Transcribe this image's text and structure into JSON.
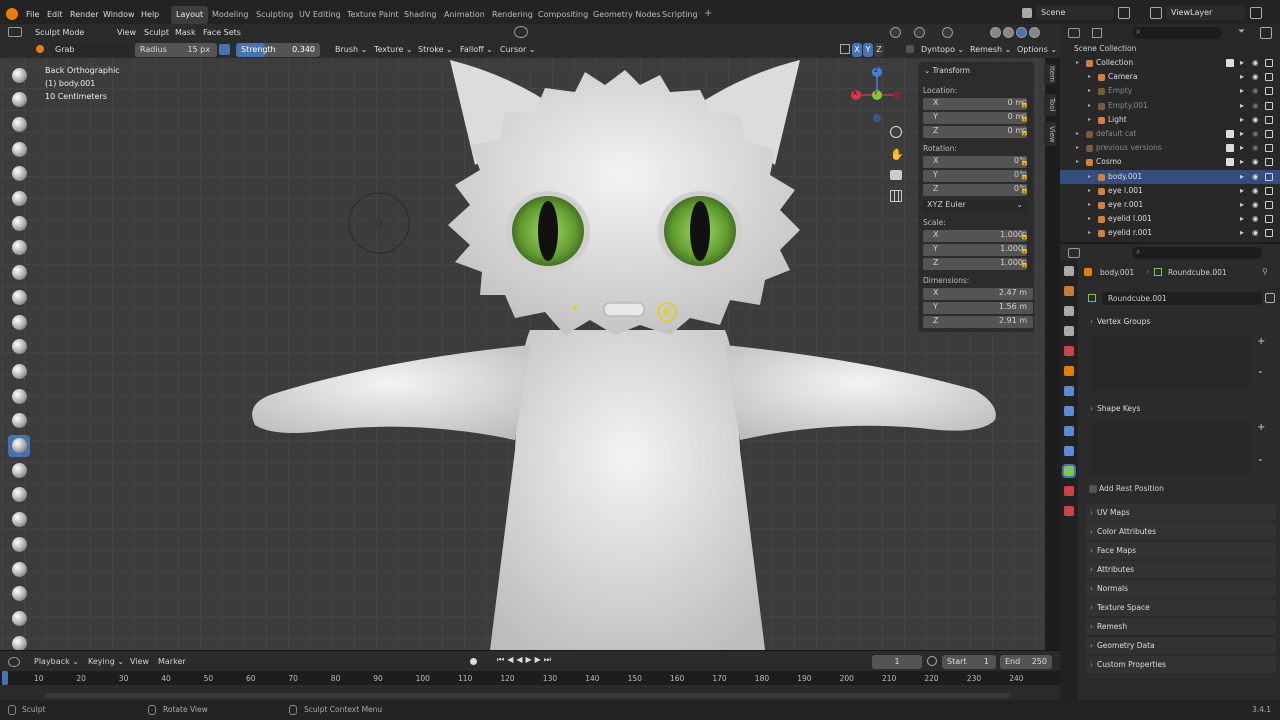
{
  "topbar": {
    "menus": [
      "File",
      "Edit",
      "Render",
      "Window",
      "Help"
    ],
    "workspaces": [
      "Layout",
      "Modeling",
      "Sculpting",
      "UV Editing",
      "Texture Paint",
      "Shading",
      "Animation",
      "Rendering",
      "Compositing",
      "Geometry Nodes",
      "Scripting"
    ],
    "scene": "Scene",
    "view_layer": "ViewLayer"
  },
  "header": {
    "mode": "Sculpt Mode",
    "menus": [
      "View",
      "Sculpt",
      "Mask",
      "Face Sets"
    ],
    "brush": "Grab",
    "radius_label": "Radius",
    "radius_value": "15 px",
    "strength_label": "Strength",
    "strength_value": "0.340",
    "dropdowns": [
      "Brush",
      "Texture",
      "Stroke",
      "Falloff",
      "Cursor"
    ],
    "axes": [
      "X",
      "Y",
      "Z"
    ],
    "right": [
      "Dyntopo",
      "Remesh",
      "Options"
    ]
  },
  "viewport": {
    "view_name": "Back Orthographic",
    "object_line": "(1) body.001",
    "scale_line": "10 Centimeters",
    "gizmo": {
      "x": "X",
      "y": "Y",
      "z": "Z"
    }
  },
  "npanel": {
    "title": "Transform",
    "location_label": "Location:",
    "location": [
      "0 m",
      "0 m",
      "0 m"
    ],
    "rotation_label": "Rotation:",
    "rotation": [
      "0°",
      "0°",
      "0°"
    ],
    "rotation_mode": "XYZ Euler",
    "scale_label": "Scale:",
    "scale": [
      "1.000",
      "1.000",
      "1.000"
    ],
    "dimensions_label": "Dimensions:",
    "dimensions": [
      "2.47 m",
      "1.56 m",
      "2.91 m"
    ],
    "axes": [
      "X",
      "Y",
      "Z"
    ],
    "tabs": [
      "Item",
      "Tool",
      "View"
    ]
  },
  "outliner": {
    "root": "Scene Collection",
    "items": [
      {
        "label": "Collection",
        "indent": 1
      },
      {
        "label": "Camera",
        "indent": 2
      },
      {
        "label": "Empty",
        "indent": 2,
        "dim": true
      },
      {
        "label": "Empty.001",
        "indent": 2,
        "dim": true
      },
      {
        "label": "Light",
        "indent": 2
      },
      {
        "label": "default cat",
        "indent": 1,
        "dim": true
      },
      {
        "label": "previous versions",
        "indent": 1,
        "dim": true
      },
      {
        "label": "Cosmo",
        "indent": 1
      },
      {
        "label": "body.001",
        "indent": 2,
        "selected": true
      },
      {
        "label": "eye l.001",
        "indent": 2
      },
      {
        "label": "eye r.001",
        "indent": 2
      },
      {
        "label": "eyelid l.001",
        "indent": 2
      },
      {
        "label": "eyelid r.001",
        "indent": 2
      }
    ]
  },
  "properties": {
    "object": "body.001",
    "mesh": "Roundcube.001",
    "mesh_field": "Roundcube.001",
    "vertex_groups": "Vertex Groups",
    "shape_keys": "Shape Keys",
    "add_rest_position": "Add Rest Position",
    "sections": [
      "UV Maps",
      "Color Attributes",
      "Face Maps",
      "Attributes",
      "Normals",
      "Texture Space",
      "Remesh",
      "Geometry Data",
      "Custom Properties"
    ]
  },
  "timeline": {
    "menus": [
      "Playback",
      "Keying",
      "View",
      "Marker"
    ],
    "current_frame": "1",
    "start_label": "Start",
    "start": "1",
    "end_label": "End",
    "end": "250",
    "ticks": [
      "10",
      "20",
      "30",
      "40",
      "50",
      "60",
      "70",
      "80",
      "90",
      "100",
      "110",
      "120",
      "130",
      "140",
      "150",
      "160",
      "170",
      "180",
      "190",
      "200",
      "210",
      "220",
      "230",
      "240"
    ]
  },
  "status": {
    "left": "Sculpt",
    "middle": "Rotate View",
    "context": "Sculpt Context Menu",
    "version": "3.4.1"
  },
  "colors": {
    "accent": "#4772b3",
    "selection": "#334d80",
    "viewport": "#3c3c3c",
    "eye_green": "#6fae3a"
  }
}
